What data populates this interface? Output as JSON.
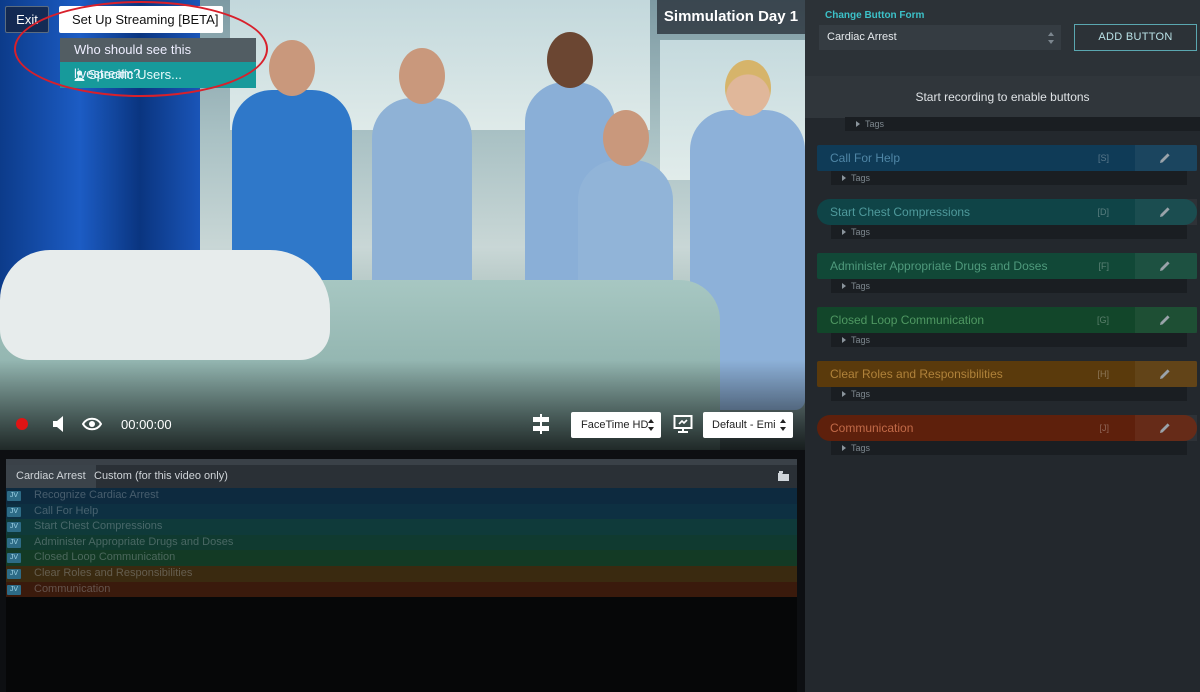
{
  "header": {
    "exit_label": "Exit",
    "stream_label": "Set Up Streaming [BETA]",
    "stream_question": "Who should see this livestream?",
    "stream_option": "Specific Users...",
    "title": "Simmulation Day 1"
  },
  "controls": {
    "timer": "00:00:00",
    "camera": "FaceTime HD",
    "microphone": "Default - Emi",
    "record_color": "#e01414"
  },
  "timeline": {
    "tabs": [
      "Cardiac Arrest",
      "Custom (for this video only)"
    ],
    "badge": "JV",
    "rows": [
      {
        "label": "Recognize Cardiac Arrest",
        "color": "#0d2a3f"
      },
      {
        "label": "Call For Help",
        "color": "#0d3042"
      },
      {
        "label": "Start Chest Compressions",
        "color": "#0f3a3a"
      },
      {
        "label": "Administer Appropriate Drugs and Doses",
        "color": "#103a30"
      },
      {
        "label": "Closed Loop Communication",
        "color": "#133a25"
      },
      {
        "label": "Clear Roles and Responsibilities",
        "color": "#3a2a10"
      },
      {
        "label": "Communication",
        "color": "#3a1a0c"
      }
    ]
  },
  "panel": {
    "form_label": "Change Button Form",
    "form_value": "Cardiac Arrest",
    "add_button": "ADD BUTTON",
    "notice": "Start recording to enable buttons",
    "tags_label": "Tags",
    "buttons": [
      {
        "label": "Call For Help",
        "key": "[S]",
        "color": "#0f3b57",
        "text": "#4f86a6",
        "pill": false
      },
      {
        "label": "Start Chest Compressions",
        "key": "[D]",
        "color": "#0f4447",
        "text": "#4f9a9c",
        "pill": true
      },
      {
        "label": "Administer Appropriate Drugs and Doses",
        "key": "[F]",
        "color": "#114837",
        "text": "#4f9a7c",
        "pill": false
      },
      {
        "label": "Closed Loop Communication",
        "key": "[G]",
        "color": "#12462a",
        "text": "#4f9862",
        "pill": false
      },
      {
        "label": "Clear Roles and Responsibilities",
        "key": "[H]",
        "color": "#5a3a0c",
        "text": "#b0823a",
        "pill": false
      },
      {
        "label": "Communication",
        "key": "[J]",
        "color": "#5e200c",
        "text": "#c26a48",
        "pill": true
      }
    ]
  }
}
